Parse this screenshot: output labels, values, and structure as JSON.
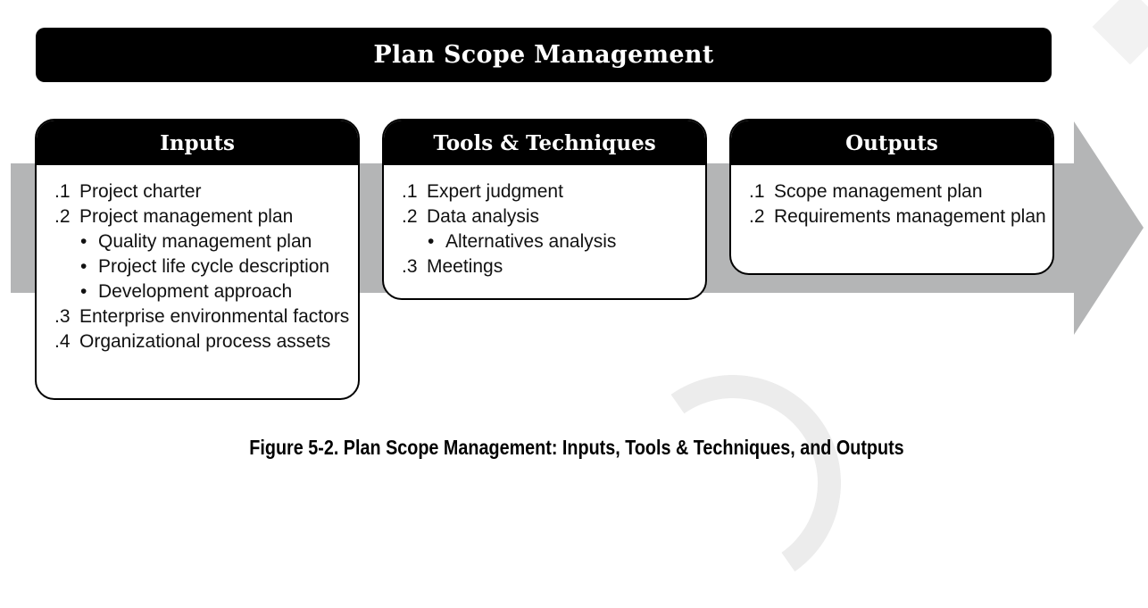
{
  "header": {
    "title": "Plan Scope Management"
  },
  "colors": {
    "arrow": "#b4b5b6",
    "box_header": "#000000",
    "box_border": "#000000",
    "text": "#111111"
  },
  "inputs": {
    "title": "Inputs",
    "items": [
      {
        "num": ".1",
        "text": "Project charter",
        "subitems": []
      },
      {
        "num": ".2",
        "text": "Project management plan",
        "subitems": [
          {
            "bullet": "•",
            "text": "Quality management plan"
          },
          {
            "bullet": "•",
            "text": "Project life cycle description"
          },
          {
            "bullet": "•",
            "text": "Development approach"
          }
        ]
      },
      {
        "num": ".3",
        "text": "Enterprise environmental factors",
        "subitems": []
      },
      {
        "num": ".4",
        "text": "Organizational process assets",
        "subitems": []
      }
    ]
  },
  "tools": {
    "title": "Tools & Techniques",
    "items": [
      {
        "num": ".1",
        "text": "Expert judgment",
        "subitems": []
      },
      {
        "num": ".2",
        "text": "Data analysis",
        "subitems": [
          {
            "bullet": "•",
            "text": "Alternatives analysis"
          }
        ]
      },
      {
        "num": ".3",
        "text": "Meetings",
        "subitems": []
      }
    ]
  },
  "outputs": {
    "title": "Outputs",
    "items": [
      {
        "num": ".1",
        "text": "Scope management plan",
        "subitems": []
      },
      {
        "num": ".2",
        "text": "Requirements management plan",
        "subitems": []
      }
    ]
  },
  "caption": "Figure 5-2. Plan Scope Management: Inputs, Tools & Techniques, and Outputs"
}
